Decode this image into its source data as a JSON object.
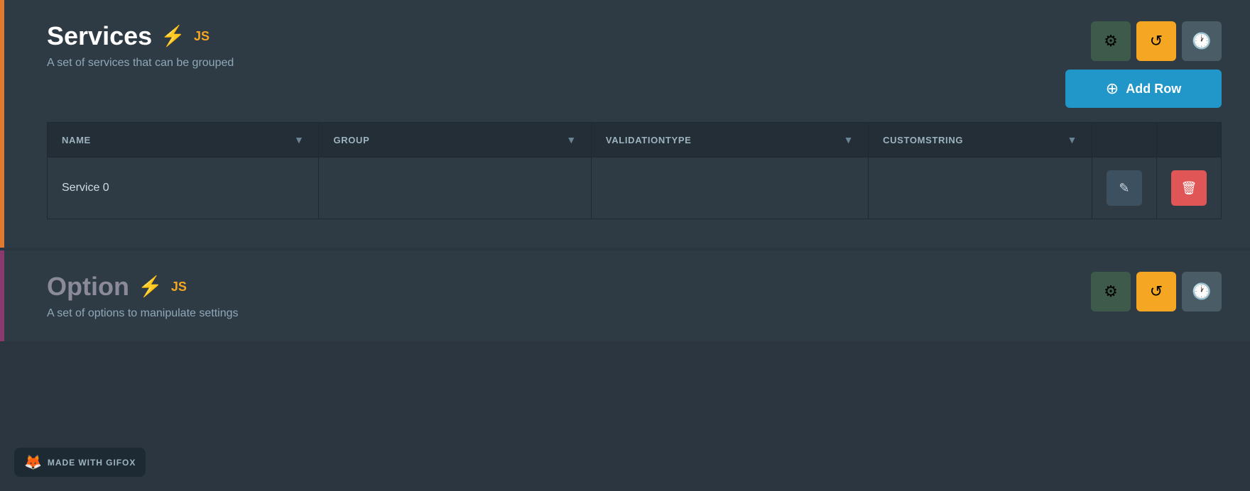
{
  "services_section": {
    "title": "Services",
    "description": "A set of services that can be grouped",
    "lightning_symbol": "⚡",
    "js_label": "JS",
    "toolbar": {
      "btn1_icon": "⚙",
      "btn2_icon": "↺",
      "btn3_icon": "🕐",
      "add_row_label": "Add Row"
    },
    "table": {
      "columns": [
        {
          "key": "name",
          "label": "NAME"
        },
        {
          "key": "group",
          "label": "GROUP"
        },
        {
          "key": "validationtype",
          "label": "VALIDATIONTYPE"
        },
        {
          "key": "customstring",
          "label": "CUSTOMSTRING"
        }
      ],
      "rows": [
        {
          "name": "Service 0",
          "group": "",
          "validationtype": "",
          "customstring": ""
        }
      ]
    }
  },
  "option_section": {
    "title": "Option",
    "description": "A set of options to manipulate settings",
    "lightning_symbol": "⚡",
    "js_label": "JS"
  },
  "watermark": {
    "text": "MADE WITH GIFOX"
  }
}
